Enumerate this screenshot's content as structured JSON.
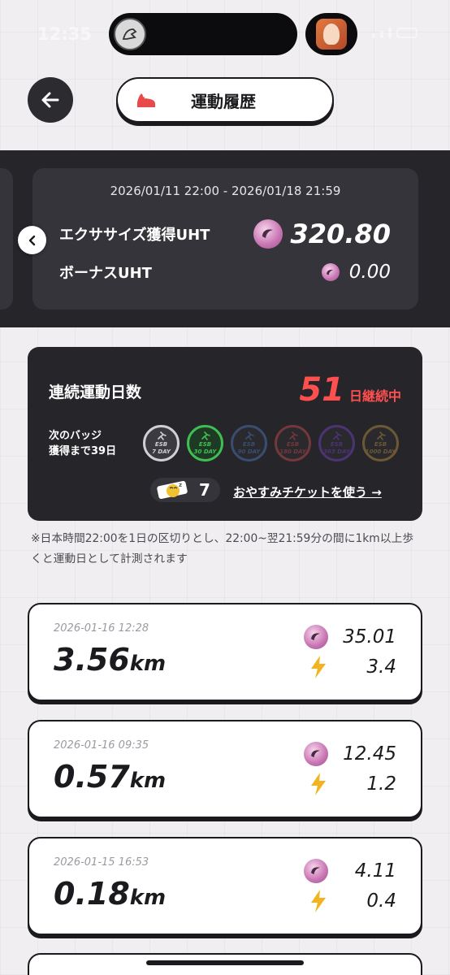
{
  "status": {
    "time": "12:35"
  },
  "header": {
    "title": "運動履歴"
  },
  "reward": {
    "period": "2026/01/11 22:00 - 2026/01/18 21:59",
    "exercise_label": "エクササイズ獲得UHT",
    "exercise_value": "320.80",
    "bonus_label": "ボーナスUHT",
    "bonus_value": "0.00"
  },
  "streak": {
    "title": "連続運動日数",
    "count": "51",
    "unit": "日継続中",
    "next_badge_line1": "次のバッジ",
    "next_badge_line2": "獲得まで39日",
    "badges": [
      {
        "top": "ESB",
        "bottom": "7 DAY",
        "color": "#cfcfd4",
        "state": "earned"
      },
      {
        "top": "ESB",
        "bottom": "30 DAY",
        "color": "#3fbf52",
        "state": "earned"
      },
      {
        "top": "ESB",
        "bottom": "90 DAY",
        "color": "#4a6fa8",
        "state": "locked"
      },
      {
        "top": "ESB",
        "bottom": "180 DAY",
        "color": "#b54848",
        "state": "locked"
      },
      {
        "top": "ESB",
        "bottom": "365 DAY",
        "color": "#6d3fb0",
        "state": "locked"
      },
      {
        "top": "ESB",
        "bottom": "1000 DAY",
        "color": "#a5823f",
        "state": "locked"
      }
    ],
    "ticket_count": "7",
    "ticket_link": "おやすみチケットを使う →"
  },
  "note": "※日本時間22:00を1日の区切りとし、22:00~翌21:59分の間に1km以上歩くと運動日として計測されます",
  "activities": [
    {
      "datetime": "2026-01-16 12:28",
      "distance": "3.56",
      "unit": "km",
      "uht": "35.01",
      "energy": "3.4"
    },
    {
      "datetime": "2026-01-16 09:35",
      "distance": "0.57",
      "unit": "km",
      "uht": "12.45",
      "energy": "1.2"
    },
    {
      "datetime": "2026-01-15 16:53",
      "distance": "0.18",
      "unit": "km",
      "uht": "4.11",
      "energy": "0.4"
    }
  ],
  "icons": {
    "back": "arrow-left-icon",
    "shoe": "sneaker-icon",
    "coin": "uht-coin-icon",
    "energy": "lightning-icon",
    "ticket": "sleep-ticket-icon"
  },
  "colors": {
    "accent_red": "#ff4f4f",
    "energy_yellow": "#f2b321",
    "coin_pink": "#c773b2"
  }
}
